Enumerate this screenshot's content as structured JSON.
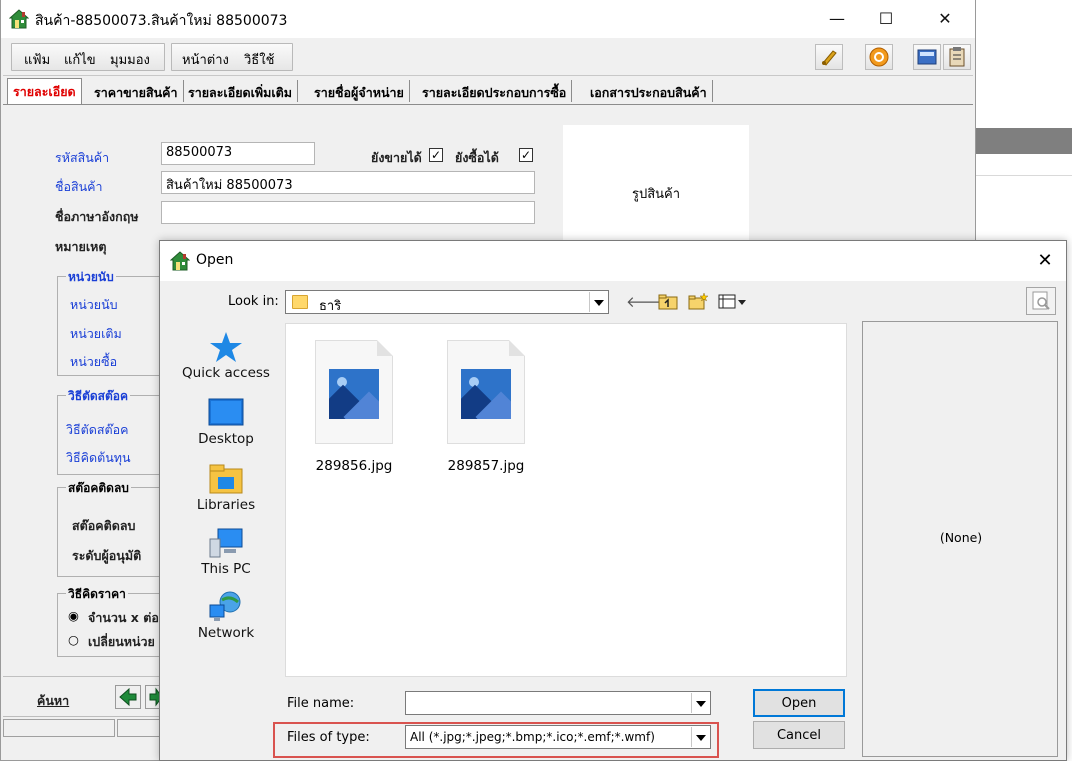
{
  "main_window": {
    "title": "สินค้า-88500073.สินค้าใหม่ 88500073",
    "controls": {
      "minimize": "—",
      "maximize": "☐",
      "close": "✕"
    }
  },
  "menu": {
    "group1": [
      "แฟ้ม",
      "แก้ไข",
      "มุมมอง"
    ],
    "group2": [
      "หน้าต่าง",
      "วิธีใช้"
    ]
  },
  "tabs": [
    {
      "label": "รายละเอียด",
      "active": true
    },
    {
      "label": "ราคาขายสินค้า"
    },
    {
      "label": "รายละเอียดเพิ่มเติม"
    },
    {
      "label": "รายชื่อผู้จำหน่าย"
    },
    {
      "label": "รายละเอียดประกอบการซื้อ"
    },
    {
      "label": "เอกสารประกอบสินค้า"
    }
  ],
  "form": {
    "product_code_label": "รหัสสินค้า",
    "product_code_value": "88500073",
    "still_selling_label": "ยังขายได้",
    "still_buying_label": "ยังซื้อได้",
    "product_name_label": "ชื่อสินค้า",
    "product_name_value": "สินค้าใหม่ 88500073",
    "english_name_label": "ชื่อภาษาอังกฤษ",
    "english_name_value": "",
    "note_label": "หมายเหตุ",
    "unit_group": {
      "title": "หน่วยนับ",
      "unit": "หน่วยนับ",
      "default_unit": "หน่วยเติม",
      "buy_unit": "หน่วยซื้อ"
    },
    "stock_group": {
      "title": "วิธีตัดสต๊อค",
      "cut_stock": "วิธีตัดสต๊อค",
      "cost_calc": "วิธีคิดต้นทุน"
    },
    "negative_group": {
      "title": "สต๊อคติดลบ",
      "negative_stock": "สต๊อคติดลบ",
      "approval_level": "ระดับผู้อนุมัติ"
    },
    "price_group": {
      "title": "วิธีคิดราคา",
      "option1": "จำนวน x ต่อ",
      "option2": "เปลี่ยนหน่วย"
    },
    "photo_label": "รูปสินค้า",
    "search_link": "ค้นหา"
  },
  "open_dialog": {
    "title": "Open",
    "close": "✕",
    "look_in_label": "Look in:",
    "look_in_value": "ธาริ",
    "places": [
      "Quick access",
      "Desktop",
      "Libraries",
      "This PC",
      "Network"
    ],
    "files": [
      "289856.jpg",
      "289857.jpg"
    ],
    "preview_text": "(None)",
    "file_name_label": "File name:",
    "file_name_value": "",
    "files_of_type_label": "Files of type:",
    "files_of_type_value": "All (*.jpg;*.jpeg;*.bmp;*.ico;*.emf;*.wmf)",
    "open_button": "Open",
    "cancel_button": "Cancel"
  },
  "colors": {
    "highlight": "#d9534f",
    "active_tab": "#e00000",
    "label_blue": "#1a3fd6"
  }
}
